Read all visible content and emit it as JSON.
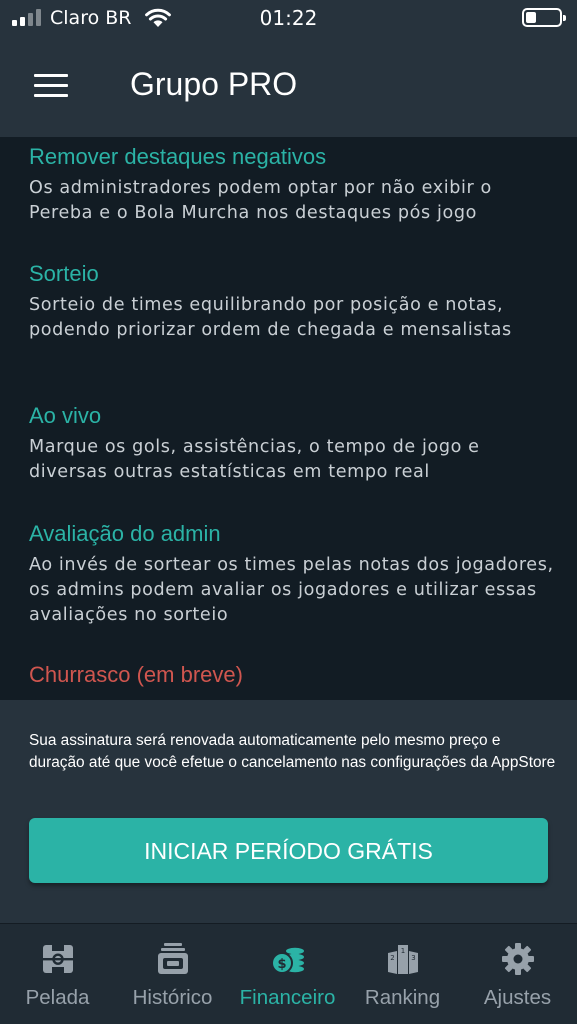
{
  "status_bar": {
    "carrier": "Claro BR",
    "time": "01:22"
  },
  "header": {
    "title": "Grupo PRO",
    "menu_icon": "hamburger-menu-icon"
  },
  "features": [
    {
      "title": "Remover destaques negativos",
      "description": "Os administradores podem optar por não exibir o Pereba e o Bola Murcha nos destaques pós jogo"
    },
    {
      "title": "Sorteio",
      "description": "Sorteio de times equilibrando por posição e notas, podendo priorizar ordem de chegada e mensalistas"
    },
    {
      "title": "Ao vivo",
      "description": "Marque os gols, assistências, o tempo de jogo e diversas outras estatísticas em tempo real"
    },
    {
      "title": "Avaliação do admin",
      "description": "Ao invés de sortear os times pelas notas dos jogadores, os admins podem avaliar os jogadores e utilizar essas avaliações no sorteio"
    },
    {
      "title": "Churrasco (em breve)",
      "description": ""
    }
  ],
  "footer": {
    "notice": "Sua assinatura será renovada automaticamente pelo mesmo preço e duração até que você efetue o cancelamento nas configurações da AppStore",
    "cta_label": "INICIAR PERÍODO GRÁTIS"
  },
  "tabs": [
    {
      "label": "Pelada",
      "icon": "field-icon",
      "active": false
    },
    {
      "label": "Histórico",
      "icon": "history-icon",
      "active": false
    },
    {
      "label": "Financeiro",
      "icon": "coins-icon",
      "active": true
    },
    {
      "label": "Ranking",
      "icon": "podium-icon",
      "active": false
    },
    {
      "label": "Ajustes",
      "icon": "gear-icon",
      "active": false
    }
  ],
  "colors": {
    "accent": "#2bb3a6",
    "header_bg": "#27333d",
    "content_bg": "#121c24",
    "coming_soon": "#d0564f",
    "tab_inactive": "#97a1aa"
  }
}
